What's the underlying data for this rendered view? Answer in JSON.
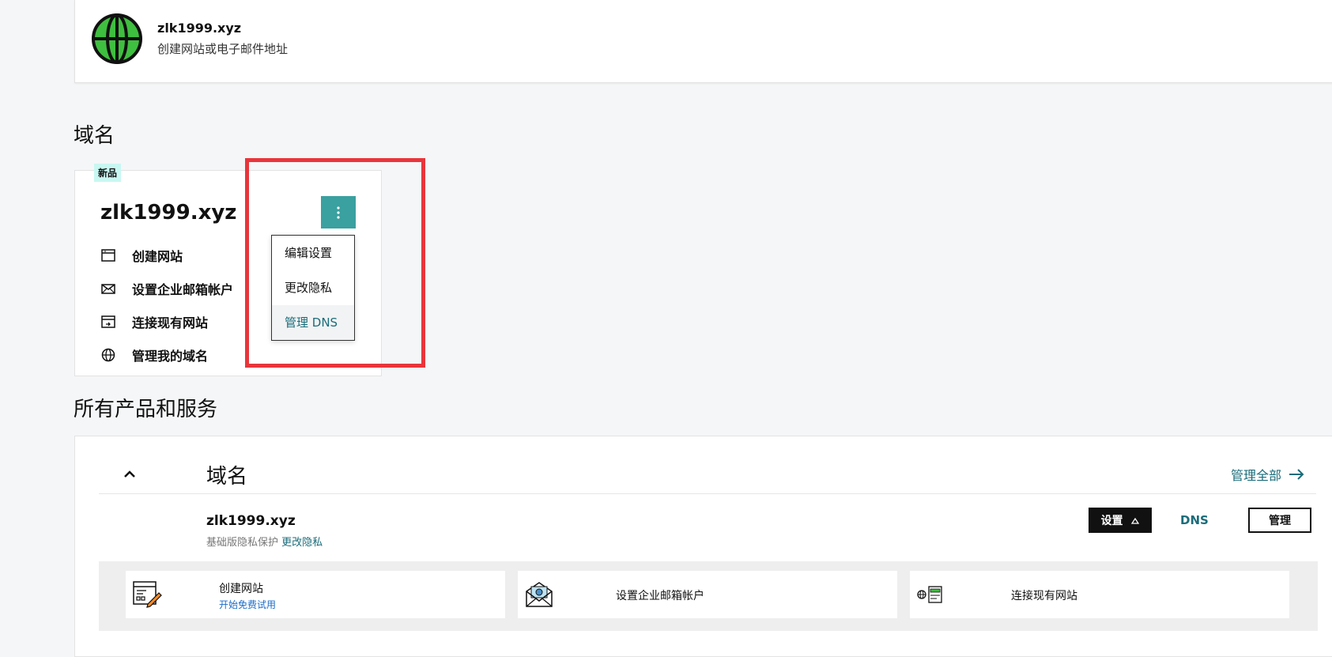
{
  "top_card": {
    "title": "zlk1999.xyz",
    "subtitle": "创建网站或电子邮件地址"
  },
  "domains_section": {
    "heading": "域名",
    "badge": "新品",
    "domain_name": "zlk1999.xyz",
    "actions": [
      {
        "label": "创建网站",
        "icon": "browser-window-icon"
      },
      {
        "label": "设置企业邮箱帐户",
        "icon": "envelope-icon"
      },
      {
        "label": "连接现有网站",
        "icon": "website-connect-icon"
      },
      {
        "label": "管理我的域名",
        "icon": "globe-icon"
      }
    ],
    "menu": {
      "items": [
        {
          "label": "编辑设置"
        },
        {
          "label": "更改隐私"
        },
        {
          "label": "管理 DNS",
          "active": true
        }
      ]
    }
  },
  "products_section": {
    "heading": "所有产品和服务",
    "category": "域名",
    "manage_all": "管理全部",
    "domain_name": "zlk1999.xyz",
    "privacy_text": "基础版隐私保护",
    "privacy_link": "更改隐私",
    "settings_button": "设置",
    "dns_button": "DNS",
    "manage_button": "管理",
    "tiles": [
      {
        "label": "创建网站",
        "sub": "开始免费试用"
      },
      {
        "label": "设置企业邮箱帐户",
        "sub": ""
      },
      {
        "label": "连接现有网站",
        "sub": ""
      }
    ]
  },
  "colors": {
    "accent_teal": "#3aa0a0",
    "link_teal": "#1a6c7a",
    "highlight_red": "#e8353b",
    "globe_green": "#3fbf3f"
  }
}
